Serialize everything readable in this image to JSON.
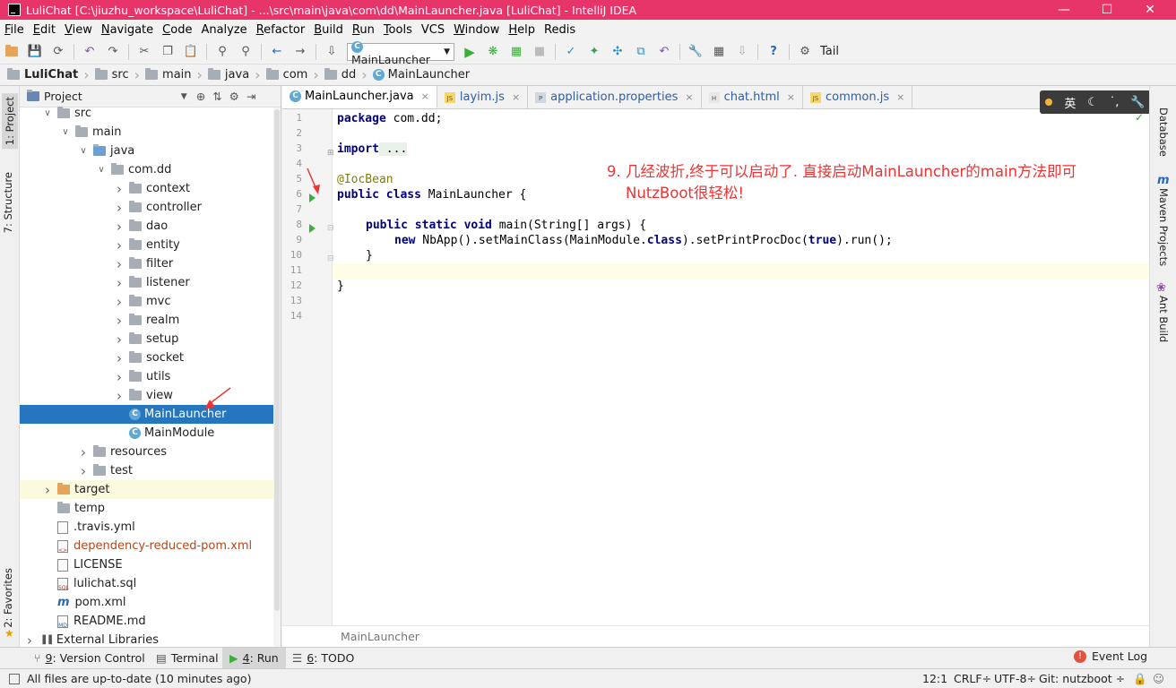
{
  "window": {
    "title": "LuliChat [C:\\jiuzhu_workspace\\LuliChat] - ...\\src\\main\\java\\com\\dd\\MainLauncher.java [LuliChat] - IntelliJ IDEA"
  },
  "menu": [
    {
      "label": "File",
      "ul": "F",
      "rest": "ile"
    },
    {
      "label": "Edit",
      "ul": "E",
      "rest": "dit"
    },
    {
      "label": "View",
      "ul": "V",
      "rest": "iew"
    },
    {
      "label": "Navigate",
      "ul": "N",
      "rest": "avigate"
    },
    {
      "label": "Code",
      "ul": "C",
      "rest": "ode"
    },
    {
      "label": "Analyze",
      "ul": "",
      "rest": "Analyze"
    },
    {
      "label": "Refactor",
      "ul": "R",
      "rest": "efactor"
    },
    {
      "label": "Build",
      "ul": "B",
      "rest": "uild"
    },
    {
      "label": "Run",
      "ul": "R",
      "rest": "un"
    },
    {
      "label": "Tools",
      "ul": "T",
      "rest": "ools"
    },
    {
      "label": "VCS",
      "ul": "",
      "rest": "VCS"
    },
    {
      "label": "Window",
      "ul": "W",
      "rest": "indow"
    },
    {
      "label": "Help",
      "ul": "H",
      "rest": "elp"
    },
    {
      "label": "Redis",
      "ul": "",
      "rest": "Redis"
    }
  ],
  "toolbar": {
    "run_config": "MainLauncher",
    "tail_label": "Tail"
  },
  "breadcrumb": [
    "LuliChat",
    "src",
    "main",
    "java",
    "com",
    "dd",
    "MainLauncher"
  ],
  "left_strip": {
    "project": "1: Project",
    "structure": "7: Structure",
    "favorites": "2: Favorites"
  },
  "right_strip": {
    "database": "Database",
    "maven": "Maven Projects",
    "ant": "Ant Build"
  },
  "project_panel": {
    "title": "Project",
    "tree": [
      {
        "label": "src",
        "type": "folder",
        "depth": 1,
        "expand": "down"
      },
      {
        "label": "main",
        "type": "folder",
        "depth": 2,
        "expand": "down"
      },
      {
        "label": "java",
        "type": "folder-blue",
        "depth": 3,
        "expand": "down"
      },
      {
        "label": "com.dd",
        "type": "folder",
        "depth": 4,
        "expand": "down"
      },
      {
        "label": "context",
        "type": "folder",
        "depth": 5,
        "expand": "right"
      },
      {
        "label": "controller",
        "type": "folder",
        "depth": 5,
        "expand": "right"
      },
      {
        "label": "dao",
        "type": "folder",
        "depth": 5,
        "expand": "right"
      },
      {
        "label": "entity",
        "type": "folder",
        "depth": 5,
        "expand": "right"
      },
      {
        "label": "filter",
        "type": "folder",
        "depth": 5,
        "expand": "right"
      },
      {
        "label": "listener",
        "type": "folder",
        "depth": 5,
        "expand": "right"
      },
      {
        "label": "mvc",
        "type": "folder",
        "depth": 5,
        "expand": "right"
      },
      {
        "label": "realm",
        "type": "folder",
        "depth": 5,
        "expand": "right"
      },
      {
        "label": "setup",
        "type": "folder",
        "depth": 5,
        "expand": "right"
      },
      {
        "label": "socket",
        "type": "folder",
        "depth": 5,
        "expand": "right"
      },
      {
        "label": "utils",
        "type": "folder",
        "depth": 5,
        "expand": "right"
      },
      {
        "label": "view",
        "type": "folder",
        "depth": 5,
        "expand": "right"
      },
      {
        "label": "MainLauncher",
        "type": "class",
        "depth": 5,
        "expand": "",
        "selected": true
      },
      {
        "label": "MainModule",
        "type": "class",
        "depth": 5,
        "expand": ""
      },
      {
        "label": "resources",
        "type": "folder",
        "depth": 3,
        "expand": "right"
      },
      {
        "label": "test",
        "type": "folder",
        "depth": 3,
        "expand": "right"
      },
      {
        "label": "target",
        "type": "folder-orange",
        "depth": 1,
        "expand": "right",
        "highlight": true
      },
      {
        "label": "temp",
        "type": "folder",
        "depth": 1,
        "expand": ""
      },
      {
        "label": ".travis.yml",
        "type": "file",
        "depth": 1,
        "expand": ""
      },
      {
        "label": "dependency-reduced-pom.xml",
        "type": "file-xml",
        "depth": 1,
        "expand": "",
        "color": "#b5471b"
      },
      {
        "label": "LICENSE",
        "type": "file",
        "depth": 1,
        "expand": ""
      },
      {
        "label": "lulichat.sql",
        "type": "file-sql",
        "depth": 1,
        "expand": ""
      },
      {
        "label": "pom.xml",
        "type": "file-maven",
        "depth": 1,
        "expand": ""
      },
      {
        "label": "README.md",
        "type": "file-md",
        "depth": 1,
        "expand": ""
      },
      {
        "label": "External Libraries",
        "type": "lib",
        "depth": 0,
        "expand": "right"
      }
    ]
  },
  "editor": {
    "tabs": [
      {
        "label": "MainLauncher.java",
        "icon": "class",
        "active": true
      },
      {
        "label": "layim.js",
        "icon": "js"
      },
      {
        "label": "application.properties",
        "icon": "props"
      },
      {
        "label": "chat.html",
        "icon": "html"
      },
      {
        "label": "common.js",
        "icon": "js"
      }
    ],
    "line_numbers": [
      "1",
      "2",
      "3",
      "4",
      "5",
      "6",
      "7",
      "8",
      "9",
      "10",
      "11",
      "12",
      "13",
      "14"
    ],
    "code": {
      "l1_kw": "package",
      "l1_rest": " com.dd;",
      "l3_kw": "import",
      "l3_rest": " ...",
      "l6": "@IocBean",
      "l7_kw": "public class",
      "l7_rest": " MainLauncher {",
      "l9_kw": "public static void",
      "l9_rest": " main(String[] args) {",
      "l10_a": "new",
      "l10_b": " NbApp().setMainClass(MainModule.",
      "l10_c": "class",
      "l10_d": ").setPrintProcDoc(",
      "l10_e": "true",
      "l10_f": ").run();",
      "l11": "}",
      "l13": "}"
    },
    "footer": "MainLauncher",
    "annotation_line1": "9. 几经波折,终于可以启动了. 直接启动MainLauncher的main方法即可",
    "annotation_line2": "NutzBoot很轻松!"
  },
  "ime": {
    "lang": "英"
  },
  "bottom_tabs": [
    {
      "num": "9",
      "label": ": Version Control"
    },
    {
      "num": "",
      "label": "Terminal"
    },
    {
      "num": "4",
      "label": ": Run",
      "active": true
    },
    {
      "num": "6",
      "label": ": TODO"
    }
  ],
  "event_log": "Event Log",
  "status": {
    "message": "All files are up-to-date (10 minutes ago)",
    "position": "12:1",
    "line_sep": "CRLF÷",
    "encoding": "UTF-8÷",
    "git": "Git: nutzboot ÷"
  },
  "colors": {
    "title_bg": "#e7356a",
    "selection": "#2675bf",
    "annotation": "#ee3333",
    "run_green": "#3cae3c"
  }
}
